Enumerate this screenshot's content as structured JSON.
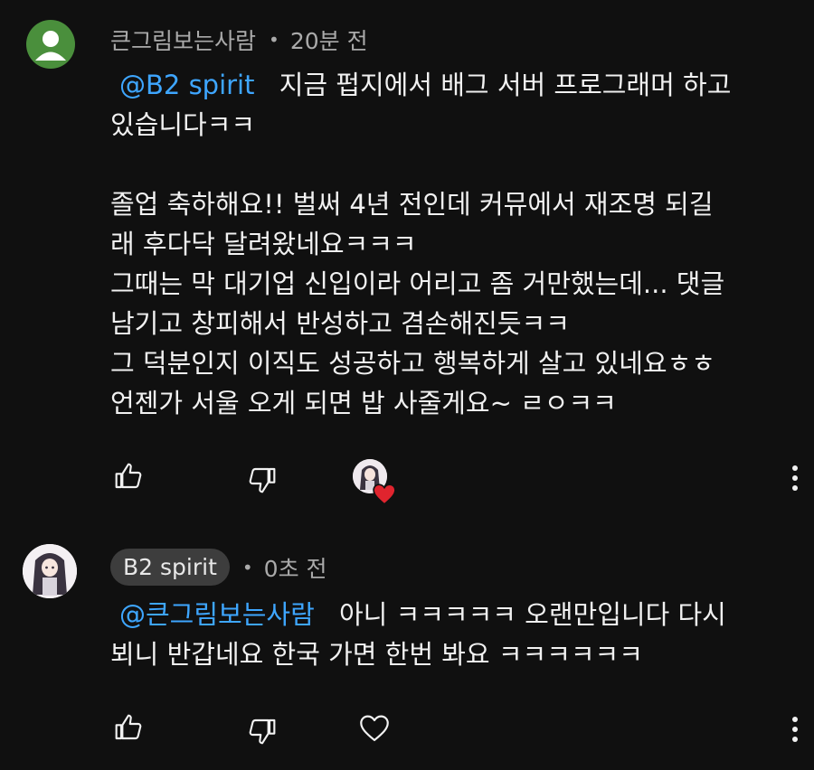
{
  "comments": [
    {
      "author": "큰그림보는사람",
      "time": "20분 전",
      "mention": "@B2 spirit",
      "lines": [
        "지금 펍지에서 배그 서버 프로그래머 하고",
        "있습니다ㅋㅋ",
        "",
        "졸업 축하해요!! 벌써 4년 전인데 커뮤에서 재조명 되길",
        "래 후다닥 달려왔네요ㅋㅋㅋ",
        "그때는 막 대기업 신입이라 어리고 좀 거만했는데... 댓글",
        "남기고 창피해서 반성하고 겸손해진듯ㅋㅋ",
        "그 덕분인지 이직도 성공하고 행복하게 살고 있네요ㅎㅎ",
        "언젠가 서울 오게 되면 밥 사줄게요~ ㄹㅇㅋㅋ"
      ],
      "icons": {
        "like": "thumb-up-icon",
        "dislike": "thumb-down-icon",
        "heart": "creator-heart-icon",
        "more": "more-vert-icon"
      }
    },
    {
      "author": "B2 spirit",
      "time": "0초 전",
      "mention": "@큰그림보는사람",
      "lines": [
        "아니 ㅋㅋㅋㅋㅋ 오랜만입니다 다시",
        "뵈니 반갑네요 한국 가면 한번 봐요 ㅋㅋㅋㅋㅋㅋ"
      ],
      "icons": {
        "like": "thumb-up-icon",
        "dislike": "thumb-down-icon",
        "heart": "heart-outline-icon",
        "more": "more-vert-icon"
      }
    }
  ],
  "colors": {
    "background": "#101010",
    "mention": "#3ea6ff",
    "meta": "#aaaaaa",
    "heart": "#e0242e",
    "avatar_default": "#4a8f3c"
  }
}
